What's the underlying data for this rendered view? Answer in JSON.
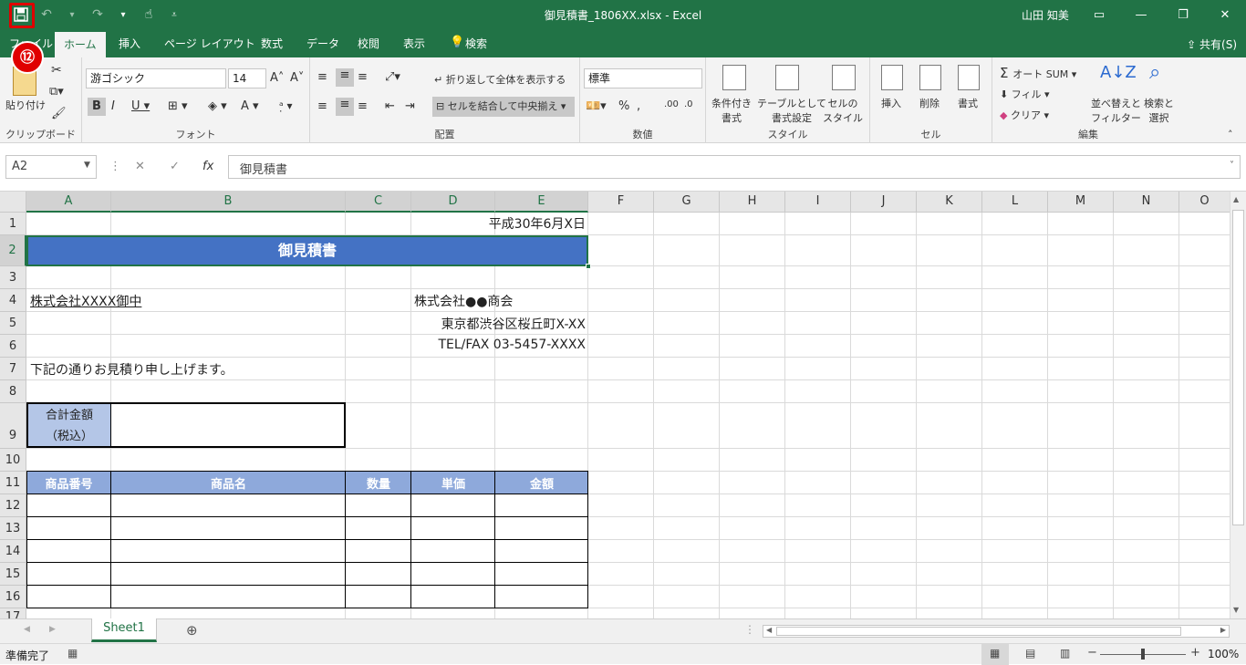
{
  "window": {
    "title": "御見積書_1806XX.xlsx  -  Excel",
    "user": "山田 知美"
  },
  "qat": {
    "save_icon": "save-icon",
    "undo_icon": "undo-icon",
    "redo_icon": "redo-icon",
    "touch_icon": "touch-mode-icon"
  },
  "step_badge": "⑫",
  "tabs": [
    "ファイル",
    "ホーム",
    "挿入",
    "ページ レイアウト",
    "数式",
    "データ",
    "校閲",
    "表示",
    "検索"
  ],
  "share": "共有(S)",
  "ribbon": {
    "clipboard": {
      "paste": "貼り付け",
      "label": "クリップボード"
    },
    "font": {
      "name": "游ゴシック",
      "size": "14",
      "label": "フォント"
    },
    "align": {
      "wrap": "折り返して全体を表示する",
      "merge": "セルを結合して中央揃え",
      "label": "配置"
    },
    "number": {
      "format": "標準",
      "label": "数値"
    },
    "styles": {
      "cond": "条件付き\n書式",
      "table": "テーブルとして\n書式設定",
      "cell": "セルの\nスタイル",
      "label": "スタイル"
    },
    "cells": {
      "insert": "挿入",
      "delete": "削除",
      "format": "書式",
      "label": "セル"
    },
    "edit": {
      "autosum": "オート SUM",
      "fill": "フィル",
      "clear": "クリア",
      "sort": "並べ替えと\nフィルター",
      "find": "検索と\n選択",
      "label": "編集"
    }
  },
  "formula_bar": {
    "name_box": "A2",
    "content": "御見積書"
  },
  "columns": [
    "A",
    "B",
    "C",
    "D",
    "E",
    "F",
    "G",
    "H",
    "I",
    "J",
    "K",
    "L",
    "M",
    "N",
    "O"
  ],
  "rows": [
    "1",
    "2",
    "3",
    "4",
    "5",
    "6",
    "7",
    "8",
    "9",
    "10",
    "11",
    "12",
    "13",
    "14",
    "15",
    "16",
    "17"
  ],
  "sheet": {
    "date": "平成30年6月X日",
    "title": "御見積書",
    "client": "株式会社XXXX御中",
    "company": "株式会社●●商会",
    "address": "東京都渋谷区桜丘町X-XX",
    "tel": "TEL/FAX 03-5457-XXXX",
    "greeting": "下記の通りお見積り申し上げます。",
    "total_label1": "合計金額",
    "total_label2": "（税込）",
    "headers": [
      "商品番号",
      "商品名",
      "数量",
      "単価",
      "金額"
    ]
  },
  "sheet_tab": "Sheet1",
  "status": {
    "ready": "準備完了",
    "zoom": "100%"
  },
  "colors": {
    "accent": "#217346",
    "title_fill": "#4472c4",
    "header_fill": "#8ea9db",
    "label_fill": "#b4c6e7",
    "highlight": "#e00000"
  }
}
